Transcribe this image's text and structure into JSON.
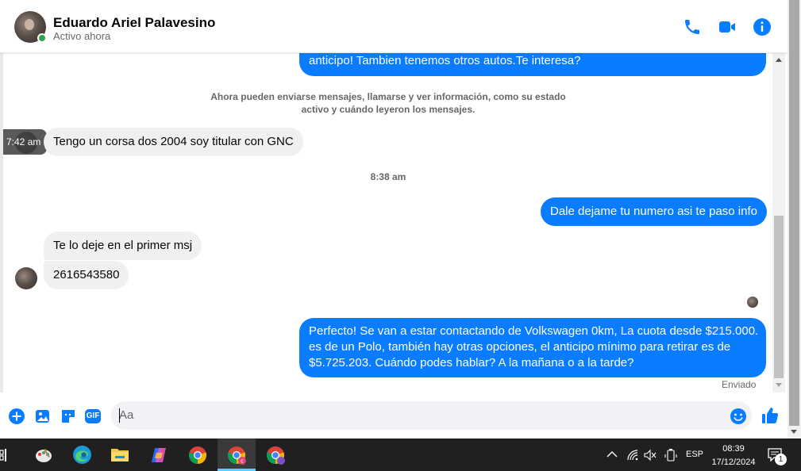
{
  "header": {
    "name": "Eduardo Ariel Palavesino",
    "status": "Activo ahora",
    "icons": [
      "phone-icon",
      "video-call-icon",
      "info-icon"
    ],
    "accent": "#0a7cff"
  },
  "messages": {
    "partial_top": "anticipo! Tambien tenemos otros autos.Te interesa?",
    "system_note": "Ahora pueden enviarse mensajes, llamarse y ver información, como su estado activo y cuándo leyeron los mensajes.",
    "hover_time": "7:42 am",
    "msg_corsa": "Tengo un corsa dos 2004 soy titular con GNC",
    "timestamp": "8:38 am",
    "msg_dale": "Dale dejame tu numero asi te paso info",
    "msg_primer": "Te lo deje en el primer msj",
    "msg_number": "2616543580",
    "msg_perfecto_1": "Perfecto!  Se van a estar contactando de Volkswagen 0km, La cuota desde $215.000.",
    "msg_perfecto_2": "es de un Polo, también hay otras opciones, el anticipo mínimo para retirar es de",
    "msg_perfecto_3": "$5.725.203. Cuándo podes hablar? A la mañana o a la tarde?",
    "sent_status": "Enviado"
  },
  "composer": {
    "placeholder": "Aa",
    "icons": [
      "add-icon",
      "image-icon",
      "sticker-icon",
      "gif-icon",
      "emoji-icon",
      "like-icon"
    ],
    "gif_label": "GIF"
  },
  "taskbar": {
    "apps": [
      "task-view-icon",
      "paint-icon",
      "edge-icon",
      "file-explorer-icon",
      "copilot-icon",
      "chrome-icon",
      "chrome-profile-c-icon",
      "chrome-profile-2-icon"
    ],
    "language": "ESP",
    "time": "08:39",
    "date": "17/12/2024",
    "notification_count": "1"
  }
}
